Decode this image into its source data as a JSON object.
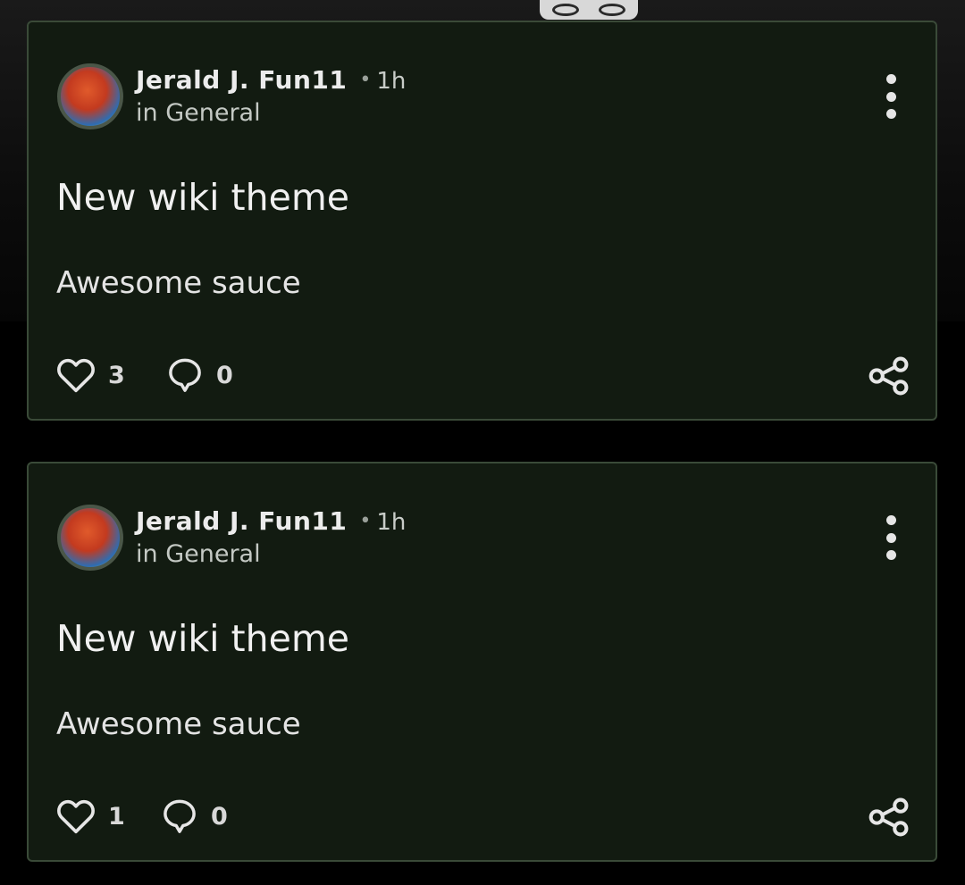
{
  "feed": {
    "posts": [
      {
        "author": "Jerald J. Fun11",
        "separator": "•",
        "time": "1h",
        "category": "in General",
        "title": "New wiki theme",
        "body": "Awesome sauce",
        "likes": "3",
        "comments": "0"
      },
      {
        "author": "Jerald J. Fun11",
        "separator": "•",
        "time": "1h",
        "category": "in General",
        "title": "New wiki theme",
        "body": "Awesome sauce",
        "likes": "1",
        "comments": "0"
      }
    ]
  },
  "icons": {
    "more": "more-vertical-icon",
    "like": "heart-icon",
    "comment": "comment-icon",
    "share": "share-icon"
  },
  "colors": {
    "card_background": "#121b11",
    "card_border": "#3a4a38",
    "page_background": "#000000",
    "text_primary": "#f0f0f0",
    "text_secondary": "#c4c9c4"
  }
}
